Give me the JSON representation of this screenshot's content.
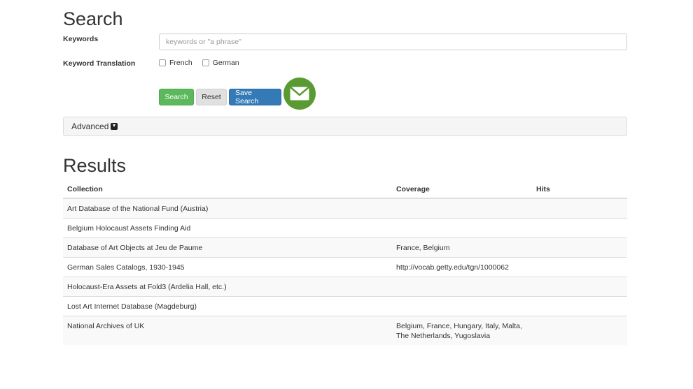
{
  "search": {
    "title": "Search",
    "keywords_label": "Keywords",
    "keywords_placeholder": "keywords or \"a phrase\"",
    "keywords_value": "",
    "translation_label": "Keyword Translation",
    "translation_options": [
      {
        "label": "French",
        "checked": false
      },
      {
        "label": "German",
        "checked": false
      }
    ],
    "buttons": {
      "search": "Search",
      "reset": "Reset",
      "save": "Save Search"
    },
    "advanced_label": "Advanced"
  },
  "results": {
    "title": "Results",
    "columns": [
      "Collection",
      "Coverage",
      "Hits"
    ],
    "rows": [
      {
        "collection": "Art Database of the National Fund (Austria)",
        "coverage": "",
        "hits": ""
      },
      {
        "collection": "Belgium Holocaust Assets Finding Aid",
        "coverage": "",
        "hits": ""
      },
      {
        "collection": "Database of Art Objects at Jeu de Paume",
        "coverage": "France, Belgium",
        "hits": ""
      },
      {
        "collection": "German Sales Catalogs, 1930-1945",
        "coverage": "http://vocab.getty.edu/tgn/1000062",
        "hits": ""
      },
      {
        "collection": "Holocaust-Era Assets at Fold3 (Ardelia Hall, etc.)",
        "coverage": "",
        "hits": ""
      },
      {
        "collection": "Lost Art Internet Database (Magdeburg)",
        "coverage": "",
        "hits": ""
      },
      {
        "collection": "National Archives of UK",
        "coverage": "Belgium, France, Hungary, Italy, Malta, The Netherlands, Yugoslavia",
        "hits": ""
      }
    ]
  },
  "icons": {
    "email": "envelope-icon",
    "advanced_toggle": "caret-square-down-icon"
  },
  "colors": {
    "search_button": "#5cb85c",
    "save_button": "#337ab7",
    "reset_button": "#e0e0e0",
    "email_circle": "#5a9a32"
  }
}
